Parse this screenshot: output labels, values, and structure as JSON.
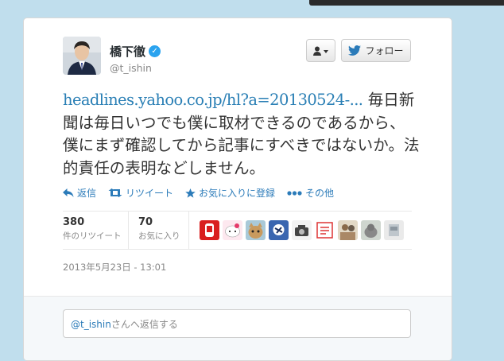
{
  "tweet": {
    "author_name": "橋下徹",
    "handle": "@t_ishin",
    "link_text": "headlines.yahoo.co.jp/hl?a=20130524-...",
    "body_text": " 毎日新聞は毎日いつでも僕に取材できるのであるから、僕にまず確認してから記事にすべきではないか。法的責任の表明などしません。",
    "timestamp": "2013年5月23日 - 13:01"
  },
  "header": {
    "follow_label": "フォロー"
  },
  "actions": [
    {
      "label": "返信",
      "icon": "reply-icon"
    },
    {
      "label": "リツイート",
      "icon": "retweet-icon"
    },
    {
      "label": "お気に入りに登録",
      "icon": "star-icon"
    },
    {
      "label": "その他",
      "icon": "more-icon"
    }
  ],
  "stats": {
    "retweets": {
      "count": "380",
      "label": "件のリツイート"
    },
    "favorites": {
      "count": "70",
      "label": "お気に入り"
    }
  },
  "reply": {
    "mention": "@t_ishin",
    "placeholder_suffix": "さんへ返信する"
  },
  "colors": {
    "background": "#c0deed",
    "link": "#2a7fb5",
    "action": "#2b7bb9",
    "verified": "#2aa3ef"
  }
}
